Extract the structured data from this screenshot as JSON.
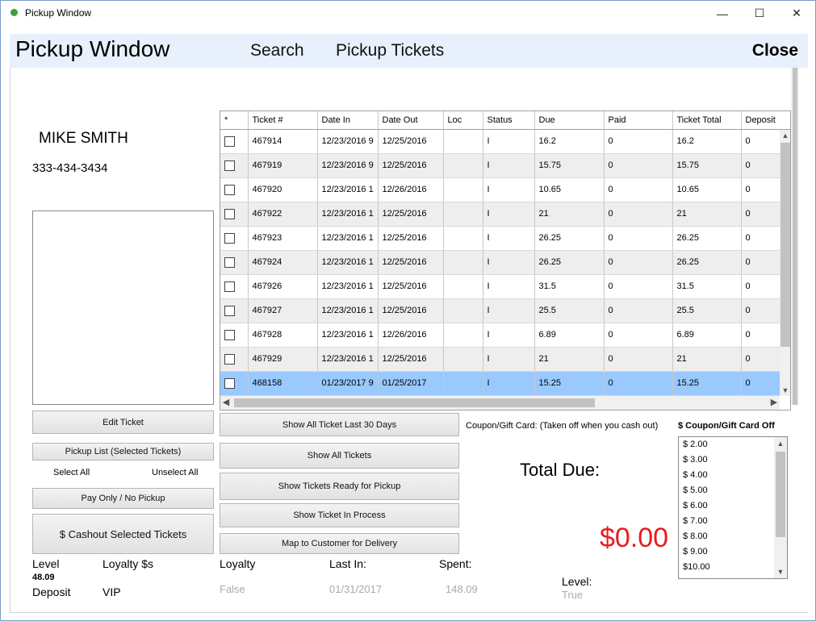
{
  "window": {
    "title": "Pickup Window",
    "minimize": "—",
    "maximize": "☐",
    "close": "✕"
  },
  "header": {
    "title": "Pickup Window",
    "nav_search": "Search",
    "nav_tickets": "Pickup Tickets",
    "close_label": "Close"
  },
  "customer": {
    "name": "MIKE SMITH",
    "phone": "333-434-3434"
  },
  "left_buttons": {
    "edit_ticket": "Edit Ticket",
    "pickup_list": "Pickup List (Selected Tickets)",
    "select_all": "Select All",
    "unselect_all": "Unselect All",
    "pay_only": "Pay Only / No Pickup",
    "cashout": "$ Cashout Selected Tickets"
  },
  "grid": {
    "columns": [
      "*",
      "Ticket #",
      "Date In",
      "Date Out",
      "Loc",
      "Status",
      "Due",
      "Paid",
      "Ticket Total",
      "Deposit"
    ],
    "rows": [
      [
        "467914",
        "12/23/2016 9",
        "12/25/2016",
        "",
        "I",
        "16.2",
        "0",
        "16.2",
        "0"
      ],
      [
        "467919",
        "12/23/2016 9",
        "12/25/2016",
        "",
        "I",
        "15.75",
        "0",
        "15.75",
        "0"
      ],
      [
        "467920",
        "12/23/2016 1",
        "12/26/2016",
        "",
        "I",
        "10.65",
        "0",
        "10.65",
        "0"
      ],
      [
        "467922",
        "12/23/2016 1",
        "12/25/2016",
        "",
        "I",
        "21",
        "0",
        "21",
        "0"
      ],
      [
        "467923",
        "12/23/2016 1",
        "12/25/2016",
        "",
        "I",
        "26.25",
        "0",
        "26.25",
        "0"
      ],
      [
        "467924",
        "12/23/2016 1",
        "12/25/2016",
        "",
        "I",
        "26.25",
        "0",
        "26.25",
        "0"
      ],
      [
        "467926",
        "12/23/2016 1",
        "12/25/2016",
        "",
        "I",
        "31.5",
        "0",
        "31.5",
        "0"
      ],
      [
        "467927",
        "12/23/2016 1",
        "12/25/2016",
        "",
        "I",
        "25.5",
        "0",
        "25.5",
        "0"
      ],
      [
        "467928",
        "12/23/2016 1",
        "12/26/2016",
        "",
        "I",
        "6.89",
        "0",
        "6.89",
        "0"
      ],
      [
        "467929",
        "12/23/2016 1",
        "12/25/2016",
        "",
        "I",
        "21",
        "0",
        "21",
        "0"
      ],
      [
        "468158",
        "01/23/2017 9",
        "01/25/2017",
        "",
        "I",
        "15.25",
        "0",
        "15.25",
        "0"
      ]
    ],
    "selected_row": 10
  },
  "mid_buttons": {
    "show_30": "Show All Ticket Last 30 Days",
    "show_all": "Show All Tickets",
    "show_ready": "Show Tickets Ready for Pickup",
    "show_process": "Show Ticket In Process",
    "map_delivery": "Map to Customer for Delivery"
  },
  "coupon": {
    "note": "Coupon/Gift Card: (Taken off when you cash out)",
    "list_title": "$ Coupon/Gift Card Off",
    "items": [
      "$ 2.00",
      "$ 3.00",
      "$ 4.00",
      "$ 5.00",
      "$ 6.00",
      "$ 7.00",
      "$ 8.00",
      "$ 9.00",
      "$10.00"
    ]
  },
  "totals": {
    "label": "Total Due:",
    "value": "$0.00"
  },
  "stats": {
    "level_label": "Level",
    "level_amount": "48.09",
    "loyalty_dollars_label": "Loyalty $s",
    "deposit_label": "Deposit",
    "vip_label": "VIP",
    "loyalty_label": "Loyalty",
    "loyalty_value": "False",
    "last_in_label": "Last In:",
    "last_in_value": "01/31/2017",
    "spent_label": "Spent:",
    "spent_value": "148.09",
    "level2_label": "Level:",
    "level2_value": "True"
  },
  "icons": {
    "up": "▲",
    "down": "▼",
    "left": "◀",
    "right": "▶"
  }
}
